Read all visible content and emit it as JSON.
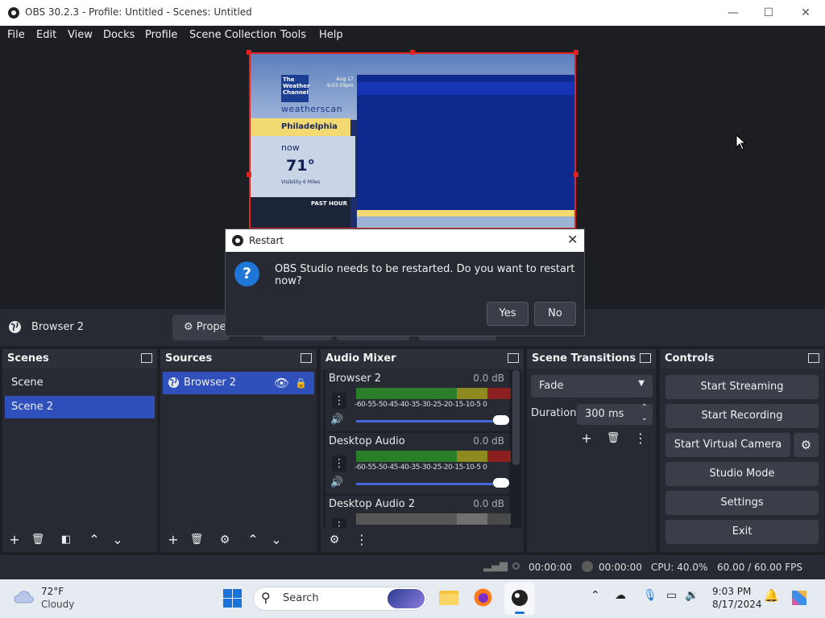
{
  "window": {
    "title": "OBS 30.2.3 - Profile: Untitled - Scenes: Untitled"
  },
  "menu": [
    "File",
    "Edit",
    "View",
    "Docks",
    "Profile",
    "Scene Collection",
    "Tools",
    "Help"
  ],
  "preview": {
    "weather": {
      "logo": "The Weather Channel",
      "brand": "weatherscan",
      "date": "Aug 17",
      "time": "9:03:59pm",
      "city": "Philadelphia",
      "now": "now",
      "temp": "71°",
      "visibility": "Visibility 6 Miles",
      "past_hour": "PAST HOUR"
    }
  },
  "source_toolbar": {
    "selected_source": "Browser 2",
    "properties_label": "Prope"
  },
  "docks": {
    "scenes": {
      "title": "Scenes",
      "items": [
        "Scene",
        "Scene 2"
      ],
      "selected": "Scene 2"
    },
    "sources": {
      "title": "Sources",
      "items": [
        "Browser 2"
      ]
    },
    "audio_mixer": {
      "title": "Audio Mixer",
      "ticks": "-60-55-50-45-40-35-30-25-20-15-10-5 0",
      "channels": [
        {
          "name": "Browser 2",
          "db": "0.0 dB"
        },
        {
          "name": "Desktop Audio",
          "db": "0.0 dB"
        },
        {
          "name": "Desktop Audio 2",
          "db": "0.0 dB"
        }
      ]
    },
    "scene_transitions": {
      "title": "Scene Transitions",
      "transition": "Fade",
      "duration_label": "Duration",
      "duration_value": "300 ms"
    },
    "controls": {
      "title": "Controls",
      "buttons": [
        "Start Streaming",
        "Start Recording",
        "Start Virtual Camera",
        "Studio Mode",
        "Settings",
        "Exit"
      ]
    }
  },
  "status": {
    "stream_time": "00:00:00",
    "rec_time": "00:00:00",
    "cpu": "CPU: 40.0%",
    "fps": "60.00 / 60.00 FPS"
  },
  "dialog": {
    "title": "Restart",
    "message": "OBS Studio needs to be restarted. Do you want to restart now?",
    "yes": "Yes",
    "no": "No"
  },
  "taskbar": {
    "weather_temp": "72°F",
    "weather_desc": "Cloudy",
    "search_label": "Search",
    "time": "9:03 PM",
    "date": "8/17/2024"
  }
}
